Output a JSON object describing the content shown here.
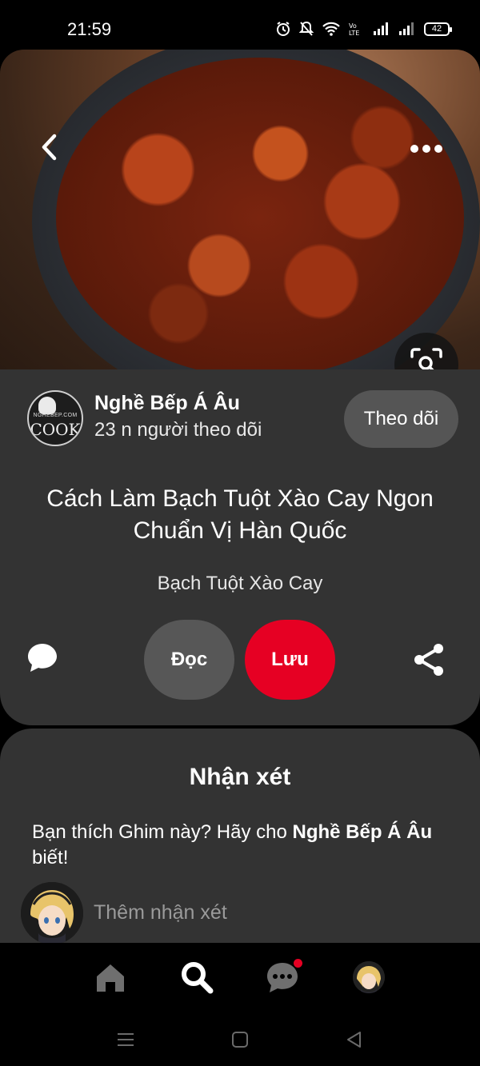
{
  "status_bar": {
    "time": "21:59",
    "battery": "42"
  },
  "hero": {
    "image_description_icon": "food-photo",
    "back_icon": "chevron-left-icon",
    "more_icon": "more-dots-icon",
    "visual_search_icon": "visual-search-icon"
  },
  "publisher": {
    "name": "Nghề Bếp Á Âu",
    "followers": "23 n người theo dõi",
    "follow_label": "Theo dõi",
    "logo_small": "NGHEBEP.COM",
    "logo_main": "COOK"
  },
  "pin": {
    "title": "Cách Làm Bạch Tuột Xào Cay Ngon Chuẩn Vị Hàn Quốc",
    "subtitle": "Bạch Tuột Xào Cay",
    "read_label": "Đọc",
    "save_label": "Lưu"
  },
  "comments": {
    "heading": "Nhận xét",
    "prompt_prefix": "Bạn thích Ghim này? Hãy cho ",
    "prompt_name": "Nghề Bếp Á Âu",
    "prompt_suffix": " biết!",
    "add_placeholder": "Thêm nhận xét"
  },
  "nav": {
    "items": [
      "home-icon",
      "search-icon",
      "messages-icon",
      "profile-avatar"
    ]
  },
  "colors": {
    "accent": "#e60023",
    "card": "#333333",
    "button": "#555555"
  }
}
